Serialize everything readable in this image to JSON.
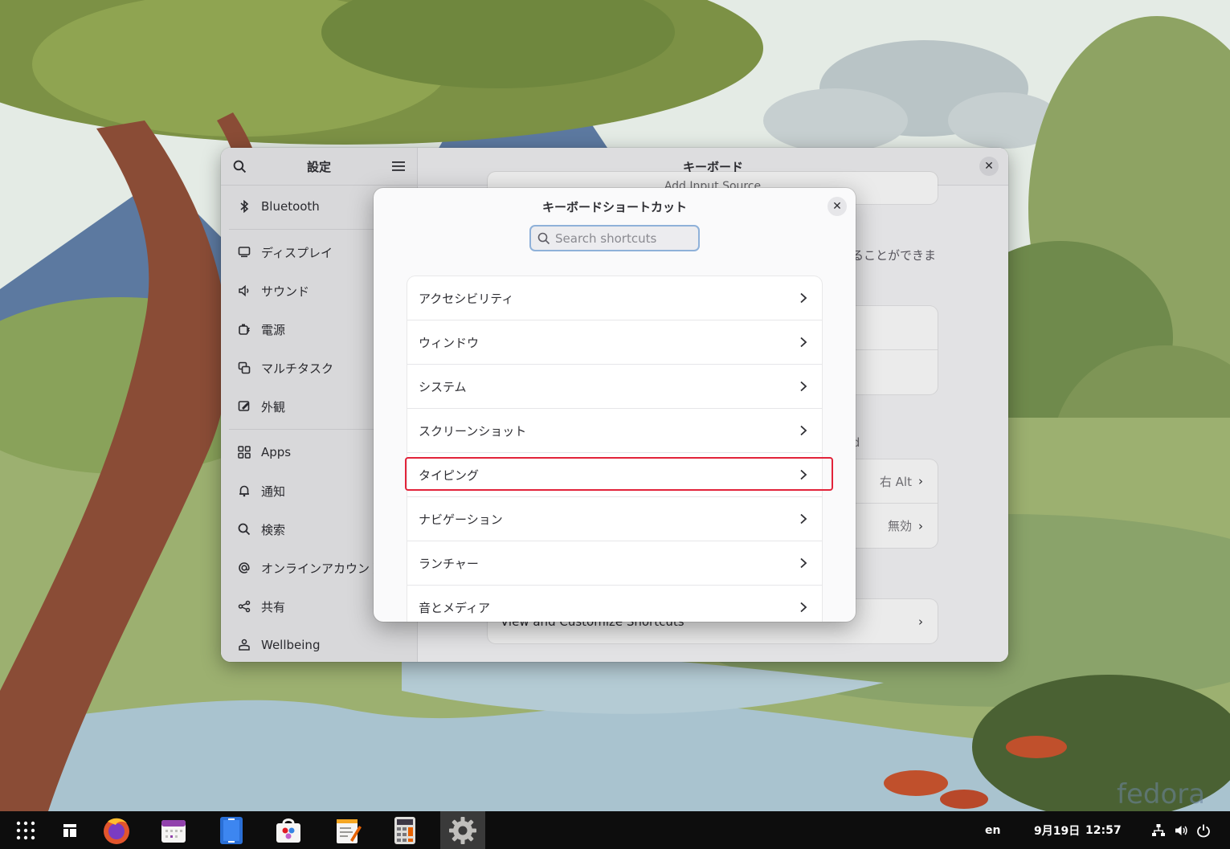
{
  "settings": {
    "sidebar_title": "設定",
    "content_title": "キーボード",
    "sidebar_items": [
      {
        "label": "Bluetooth",
        "icon": "bluetooth-icon"
      },
      {
        "label": "ディスプレイ",
        "icon": "display-icon"
      },
      {
        "label": "サウンド",
        "icon": "speaker-icon"
      },
      {
        "label": "電源",
        "icon": "power-icon"
      },
      {
        "label": "マルチタスク",
        "icon": "multitasking-icon"
      },
      {
        "label": "外観",
        "icon": "appearance-icon"
      },
      {
        "label": "Apps",
        "icon": "apps-grid-icon"
      },
      {
        "label": "通知",
        "icon": "bell-icon"
      },
      {
        "label": "検索",
        "icon": "search-icon"
      },
      {
        "label": "オンラインアカウント",
        "icon": "at-sign-icon"
      },
      {
        "label": "共有",
        "icon": "share-icon"
      },
      {
        "label": "Wellbeing",
        "icon": "wellbeing-icon"
      }
    ],
    "background": {
      "add_input_source": "Add Input Source",
      "partial_text": "ることができま",
      "partial_rd": "rd",
      "alt_value": "右 Alt",
      "disabled_value": "無効",
      "view_shortcuts": "View and Customize Shortcuts"
    }
  },
  "dialog": {
    "title": "キーボードショートカット",
    "search_placeholder": "Search shortcuts",
    "categories": [
      "アクセシビリティ",
      "ウィンドウ",
      "システム",
      "スクリーンショット",
      "タイピング",
      "ナビゲーション",
      "ランチャー",
      "音とメディア"
    ],
    "highlight_color": "#e2233a"
  },
  "taskbar": {
    "apps": [
      "app-grid-icon",
      "workspaces-icon",
      "firefox-icon",
      "calendar-icon",
      "document-viewer-icon",
      "software-icon",
      "text-editor-icon",
      "calculator-icon",
      "settings-gear-icon"
    ],
    "language": "en",
    "date": "9月19日",
    "time": "12:57"
  },
  "wallpaper": {
    "watermark": "fedora"
  }
}
